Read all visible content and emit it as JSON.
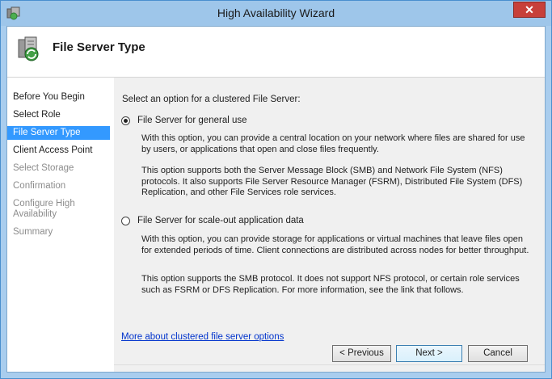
{
  "window": {
    "title": "High Availability Wizard",
    "close_label": "✕"
  },
  "header": {
    "title": "File Server Type"
  },
  "nav": {
    "items": [
      {
        "label": "Before You Begin",
        "state": "normal"
      },
      {
        "label": "Select Role",
        "state": "normal"
      },
      {
        "label": "File Server Type",
        "state": "selected"
      },
      {
        "label": "Client Access Point",
        "state": "normal"
      },
      {
        "label": "Select Storage",
        "state": "disabled"
      },
      {
        "label": "Confirmation",
        "state": "disabled"
      },
      {
        "label": "Configure High Availability",
        "state": "disabled"
      },
      {
        "label": "Summary",
        "state": "disabled"
      }
    ]
  },
  "main": {
    "prompt": "Select an option for a clustered File Server:",
    "option1": {
      "label": "File Server for general use",
      "selected": true,
      "desc1": "With this option, you can provide a central location on your network where files are shared for use by users, or applications that open and close files frequently.",
      "desc2": "This option supports both the Server Message Block (SMB) and Network File System (NFS) protocols. It also supports File Server Resource Manager (FSRM), Distributed File System (DFS) Replication, and other File Services role services."
    },
    "option2": {
      "label": "File Server for scale-out application data",
      "selected": false,
      "desc1": "With this option, you can provide storage for applications or virtual machines that leave files open for extended periods of time. Client connections are distributed across nodes for better throughput.",
      "desc2": "This option supports the SMB protocol. It does not support NFS protocol, or certain role services such as FSRM or DFS Replication. For more information, see the link that follows."
    },
    "link": "More about clustered file server options"
  },
  "buttons": {
    "previous": "< Previous",
    "next": "Next >",
    "cancel": "Cancel"
  }
}
